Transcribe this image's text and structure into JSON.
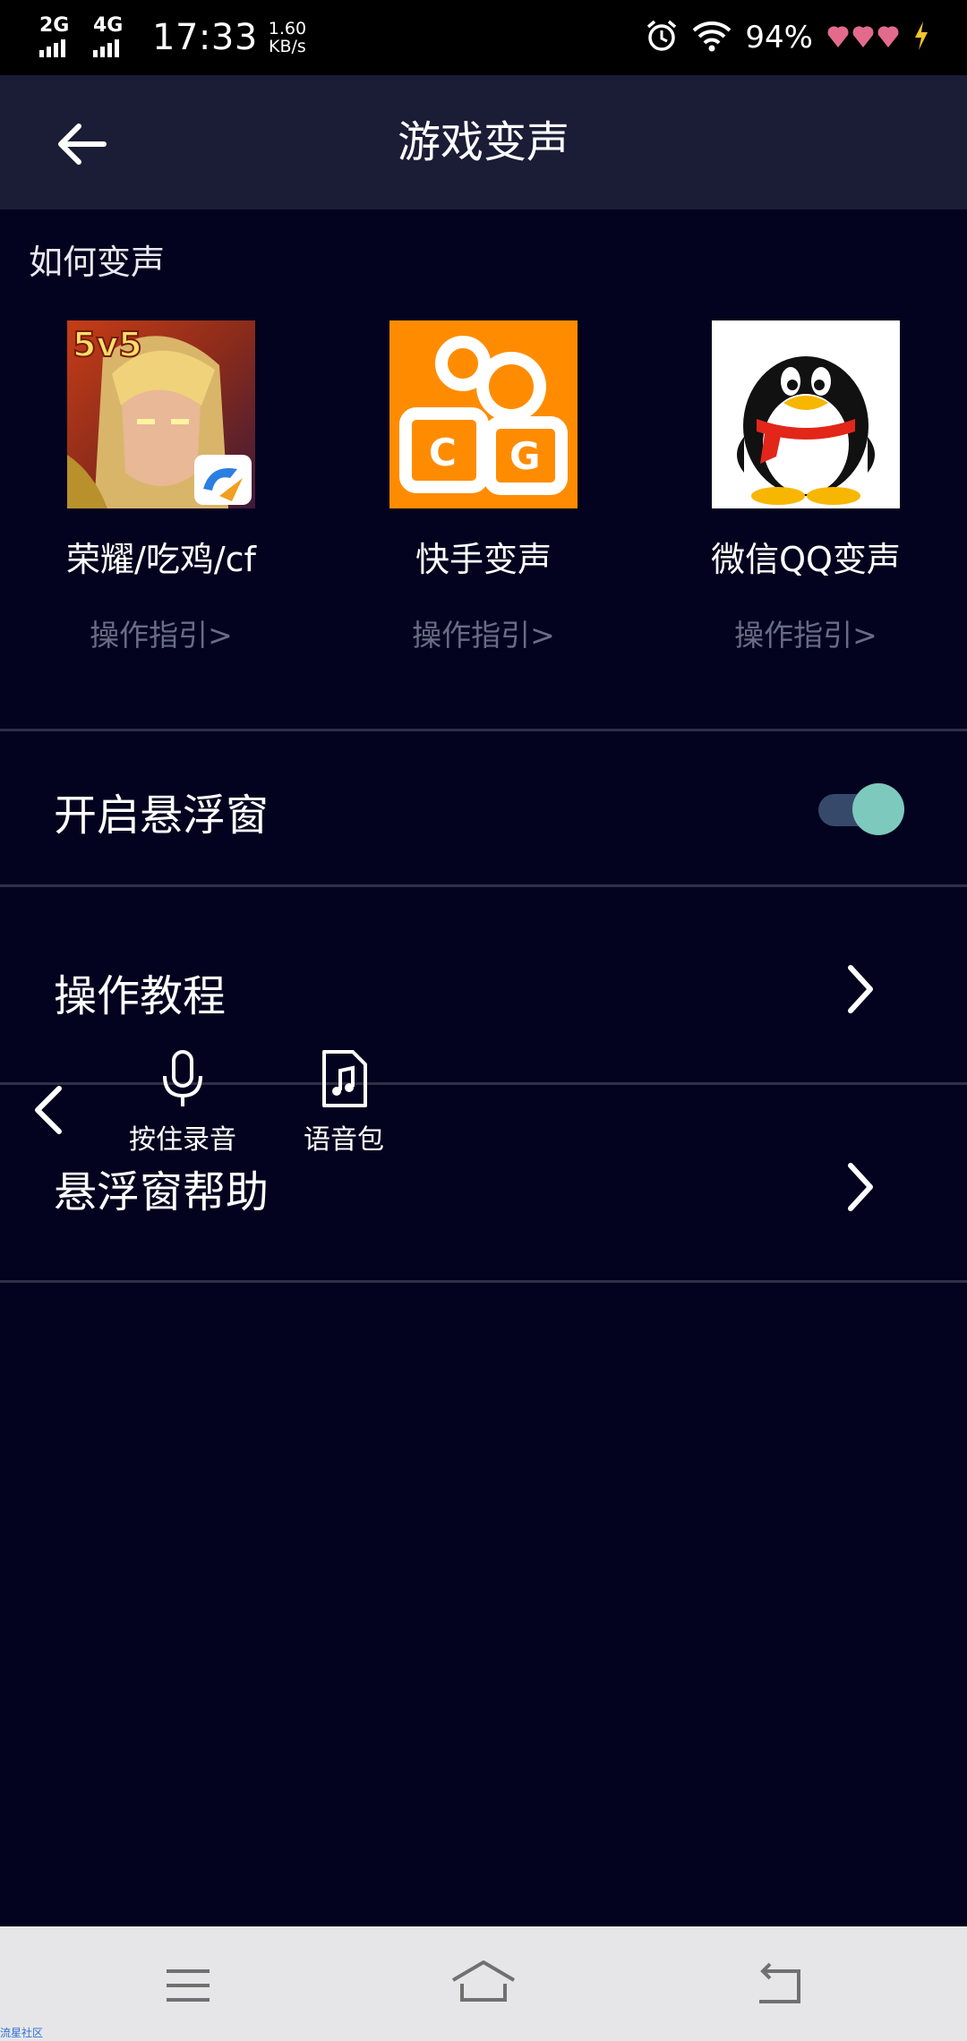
{
  "status_bar": {
    "network_1": "2G",
    "network_2": "4G",
    "time": "17:33",
    "speed_value": "1.60",
    "speed_unit": "KB/s",
    "battery": "94%",
    "icons": [
      "alarm-icon",
      "wifi-icon",
      "heart-icon",
      "charging-icon"
    ]
  },
  "header": {
    "title": "游戏变声"
  },
  "how_section": {
    "label": "如何变声",
    "apps": [
      {
        "name": "荣耀/吃鸡/cf",
        "guide": "操作指引>"
      },
      {
        "name": "快手变声",
        "guide": "操作指引>"
      },
      {
        "name": "微信QQ变声",
        "guide": "操作指引>"
      }
    ]
  },
  "settings": {
    "float_window_label": "开启悬浮窗",
    "float_window_enabled": true,
    "tutorial_label": "操作教程",
    "help_label": "悬浮窗帮助"
  },
  "float_toolbar": {
    "record_label": "按住录音",
    "voice_pack_label": "语音包"
  },
  "watermark": "流星社区",
  "colors": {
    "background": "#03031f",
    "header": "#1b1c35",
    "toggle_knob": "#7ec9bd",
    "guide_text": "#6a6c86"
  }
}
